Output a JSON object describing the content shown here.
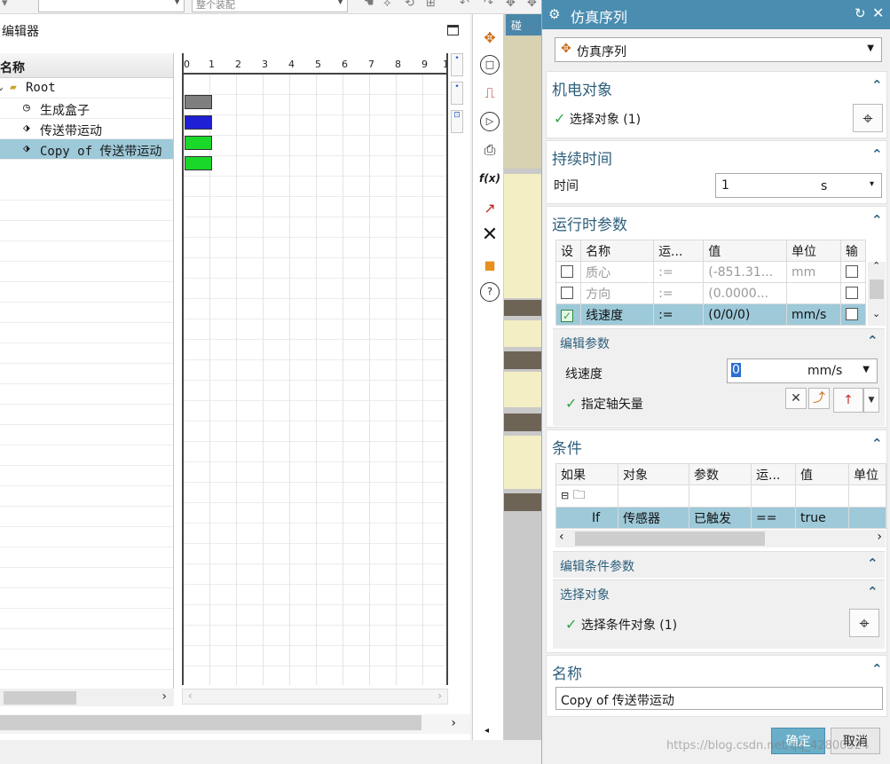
{
  "toolbar": {
    "combo2_value": "整个装配"
  },
  "editor": {
    "title": "编辑器",
    "tree_header": "名称",
    "rows": [
      {
        "label": "Root",
        "icon": "folder-icon"
      },
      {
        "label": "生成盒子",
        "icon": "clock-icon"
      },
      {
        "label": "传送带运动",
        "icon": "operation-icon"
      },
      {
        "label": "Copy of 传送带运动",
        "icon": "operation-icon"
      }
    ],
    "ruler": [
      "0",
      "1",
      "2",
      "3",
      "4",
      "5",
      "6",
      "7",
      "8",
      "9",
      "1"
    ],
    "bars": [
      {
        "color": "#7f7f7f"
      },
      {
        "color": "#1f1fd6"
      },
      {
        "color": "#19d82a"
      },
      {
        "color": "#19d82a"
      }
    ]
  },
  "view_tab": "碰",
  "dialog": {
    "title": "仿真序列",
    "type_select": "仿真序列",
    "mech_object": {
      "header": "机电对象",
      "select_label": "选择对象 (1)"
    },
    "duration": {
      "header": "持续时间",
      "time_label": "时间",
      "time_value": "1",
      "time_unit": "s"
    },
    "runtime_params": {
      "header": "运行时参数",
      "columns": [
        "设",
        "名称",
        "运...",
        "值",
        "单位",
        "输"
      ],
      "rows": [
        {
          "name": "质心",
          "op": ":=",
          "value": "(-851.31...",
          "unit": "mm",
          "checked": false,
          "style": "gray"
        },
        {
          "name": "方向",
          "op": ":=",
          "value": "(0.0000...",
          "unit": "",
          "checked": false,
          "style": "gray"
        },
        {
          "name": "线速度",
          "op": ":=",
          "value": "(0/0/0)",
          "unit": "mm/s",
          "checked": true,
          "style": "selected"
        }
      ],
      "edit_header": "编辑参数",
      "speed_label": "线速度",
      "speed_value": "0",
      "speed_unit": "mm/s",
      "axis_label": "指定轴矢量"
    },
    "conditions": {
      "header": "条件",
      "columns": [
        "如果",
        "对象",
        "参数",
        "运...",
        "值",
        "单位"
      ],
      "row": {
        "if": "If",
        "object": "传感器",
        "param": "已触发",
        "op": "==",
        "value": "true",
        "unit": ""
      },
      "edit_header": "编辑条件参数",
      "select_header": "选择对象",
      "select_label": "选择条件对象 (1)"
    },
    "name": {
      "header": "名称",
      "value": "Copy of 传送带运动"
    },
    "ok_label": "确定",
    "cancel_label": "取消"
  },
  "watermark": "https://blog.csdn.net/qq_42800524"
}
